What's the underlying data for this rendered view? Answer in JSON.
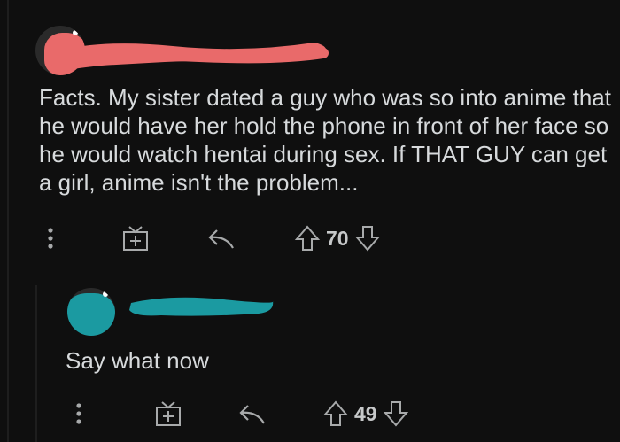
{
  "comment": {
    "body": "Facts. My sister dated a guy who was so into anime that he would have her hold the phone in front of her face so he would watch hentai during sex. If THAT GUY can get a girl, anime isn't the problem...",
    "votes": "70"
  },
  "reply": {
    "body": "Say what now",
    "votes": "49"
  },
  "colors": {
    "background": "#0f0f0f",
    "redact_red": "#e96a6a",
    "redact_teal": "#1b9aa1",
    "icon": "#a8aaab"
  },
  "icons": [
    "more-icon",
    "award-icon",
    "reply-icon",
    "upvote-icon",
    "downvote-icon"
  ]
}
